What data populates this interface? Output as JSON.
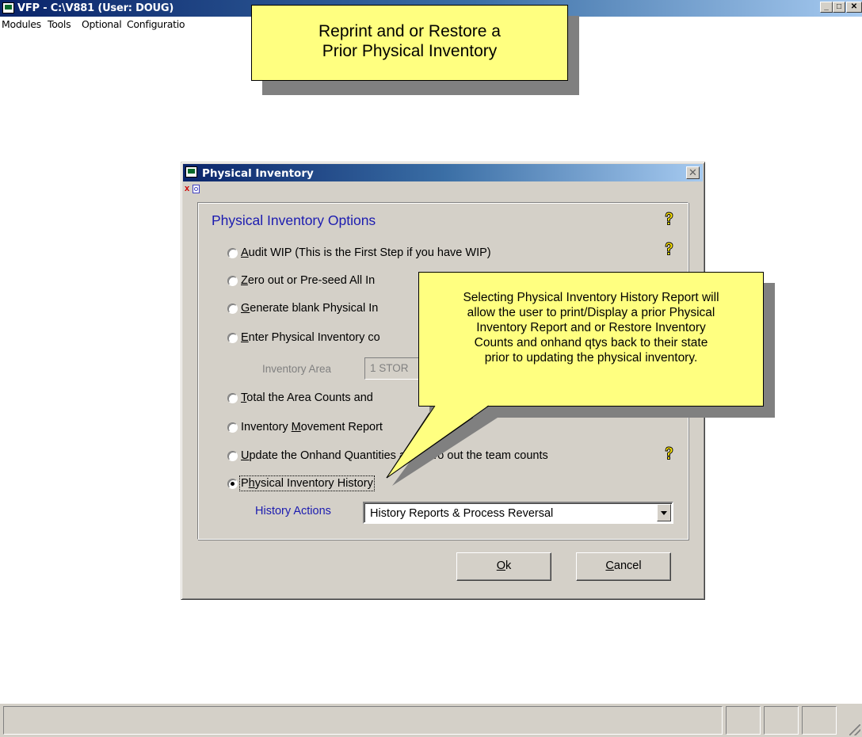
{
  "window": {
    "title": "VFP - C:\\V881  (User: DOUG)",
    "controls": [
      "minimize-icon",
      "maximize-icon",
      "close-icon"
    ]
  },
  "menu": {
    "items": [
      "Modules",
      "Tools",
      "Optional",
      "Configuratio"
    ]
  },
  "callout_top": {
    "line1": "Reprint and or Restore a",
    "line2": "Prior Physical Inventory"
  },
  "callout_mid": {
    "line1": "Selecting Physical Inventory History Report will",
    "line2": "allow the user to print/Display a prior Physical",
    "line3": "Inventory Report and or Restore Inventory",
    "line4": "Counts and onhand qtys back to their state",
    "line5": "prior to updating the physical inventory."
  },
  "dialog": {
    "title": "Physical Inventory",
    "group_title": "Physical Inventory Options",
    "options": [
      {
        "hot": "A",
        "rest": "udit WIP (This is the First Step if you have WIP)",
        "checked": false
      },
      {
        "hot": "Z",
        "rest": "ero out or Pre-seed All In",
        "checked": false
      },
      {
        "hot": "G",
        "rest": "enerate blank Physical In",
        "checked": false
      },
      {
        "hot": "E",
        "rest": "nter Physical Inventory co",
        "checked": false
      },
      {
        "hot": "T",
        "rest": "otal the Area Counts and",
        "checked": false
      },
      {
        "pre": "Inventory ",
        "hot": "M",
        "rest": "ovement Report",
        "checked": false
      },
      {
        "hot": "U",
        "rest": "pdate the Onhand Quantities and zero out the team counts",
        "checked": false
      },
      {
        "pre": "P",
        "hot": "h",
        "rest": "ysical Inventory History",
        "checked": true
      }
    ],
    "inventory_area_label": "Inventory Area",
    "inventory_area_value": "1  STOR",
    "history_actions_label": "History Actions",
    "history_actions_value": "History Reports & Process Reversal",
    "ok_hot": "O",
    "ok_rest": "k",
    "cancel_hot": "C",
    "cancel_rest": "ancel",
    "help_icon": "question-key-icon"
  },
  "colors": {
    "callout_fill": "#ffff80",
    "dialog_face": "#d4d0c8",
    "title_blue": "#0a246a",
    "group_text": "#1b1bb0"
  }
}
